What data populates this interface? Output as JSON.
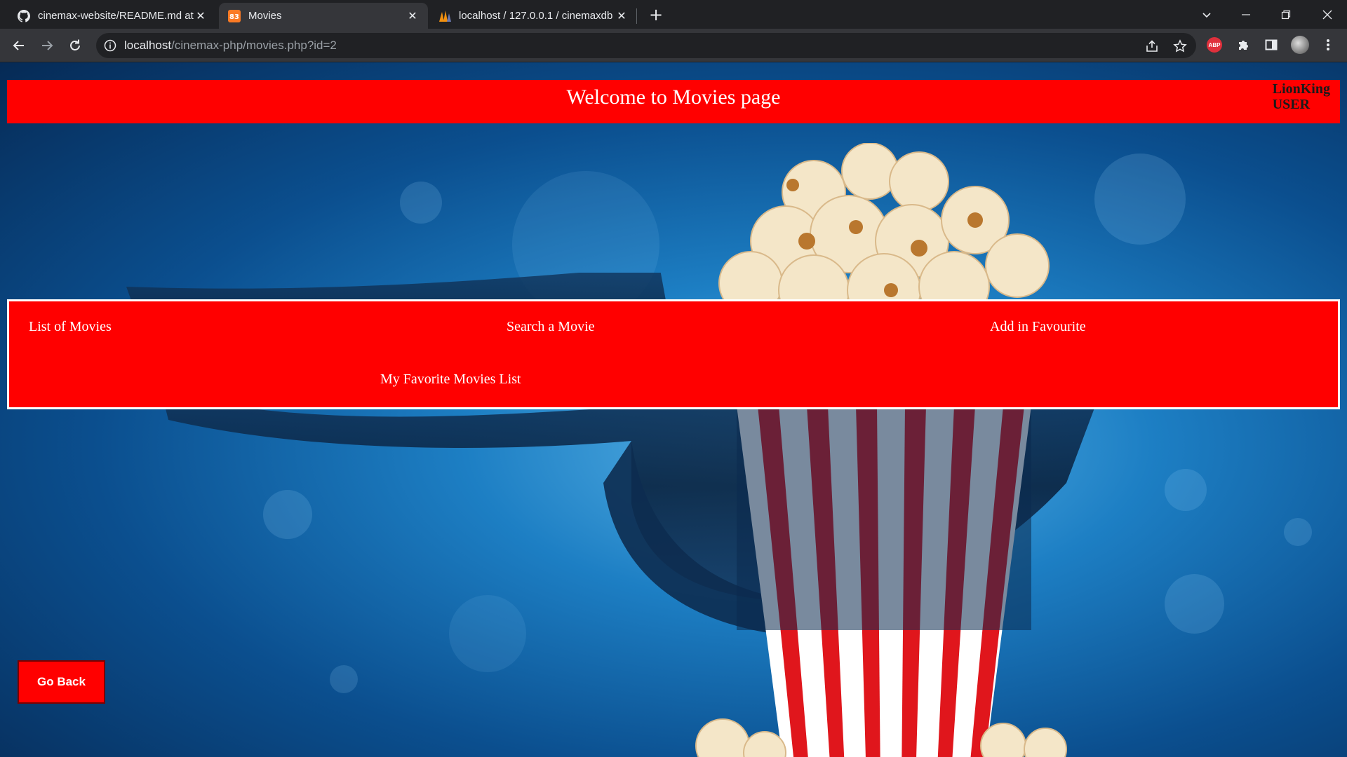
{
  "browser": {
    "tabs": [
      {
        "title": "cinemax-website/README.md at",
        "icon": "github-icon",
        "active": false
      },
      {
        "title": "Movies",
        "icon": "xampp-icon",
        "active": true
      },
      {
        "title": "localhost / 127.0.0.1 / cinemaxdb",
        "icon": "phpmyadmin-icon",
        "active": false
      }
    ],
    "address": {
      "host": "localhost",
      "path": "/cinemax-php/movies.php?id=2"
    },
    "extensions": {
      "abp_label": "ABP"
    }
  },
  "page": {
    "header": {
      "title": "Welcome to Movies page",
      "username": "LionKing",
      "role": "USER"
    },
    "nav": {
      "list_movies": "List of Movies",
      "search_movie": "Search a Movie",
      "add_favourite": "Add in Favourite",
      "favorite_list": "My Favorite Movies List"
    },
    "go_back_label": "Go Back"
  },
  "colors": {
    "accent_red": "#ff0000",
    "background_blue": "#1d7fc4"
  }
}
